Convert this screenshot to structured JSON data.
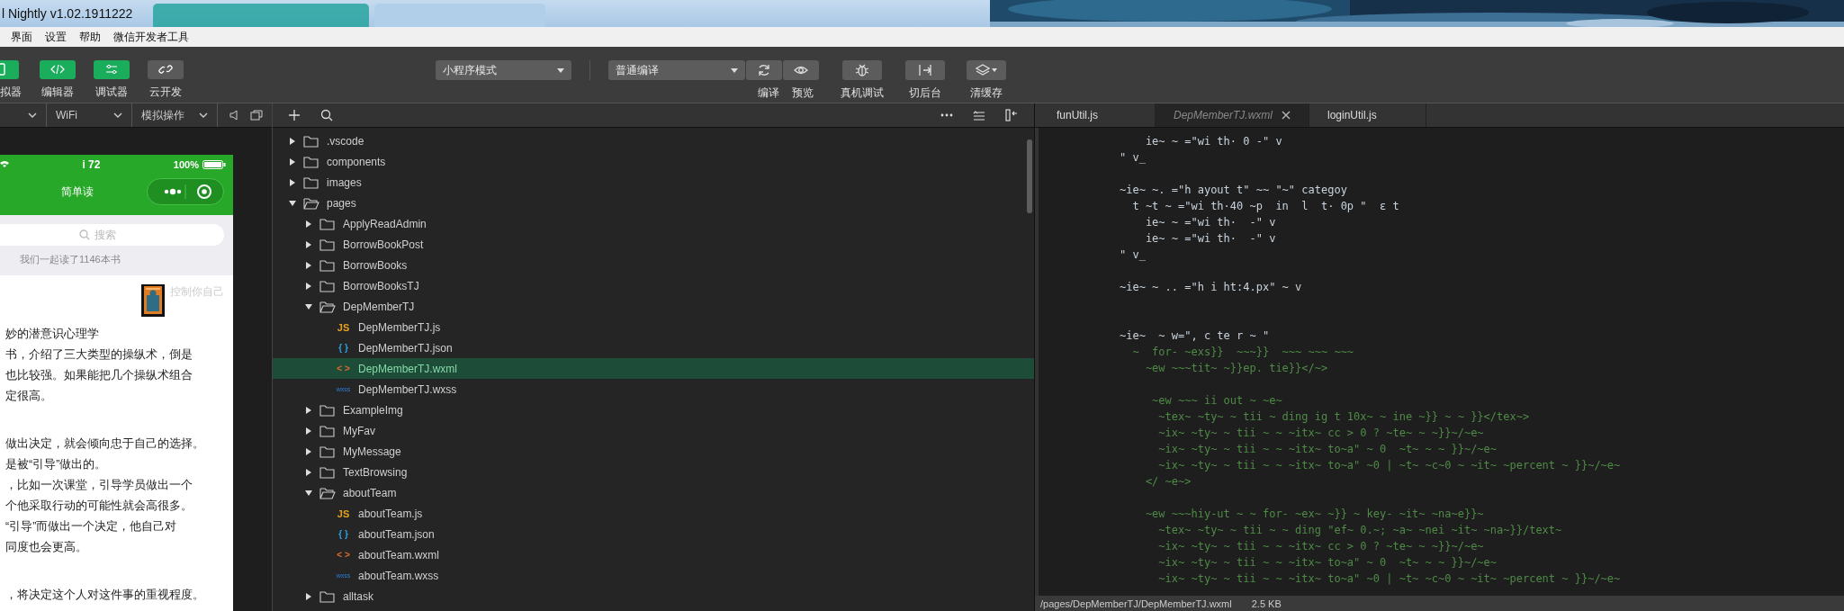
{
  "window": {
    "title": "l Nightly v1.02.1911222"
  },
  "menu": [
    "界面",
    "设置",
    "帮助",
    "微信开发者工具"
  ],
  "toolbar": {
    "views": [
      {
        "label": "拟器",
        "on": true
      },
      {
        "label": "编辑器",
        "on": true
      },
      {
        "label": "调试器",
        "on": true
      },
      {
        "label": "云开发",
        "on": false
      }
    ],
    "mode": "小程序模式",
    "compile": "普通编译",
    "actions": [
      {
        "label": "编译"
      },
      {
        "label": "预览"
      },
      {
        "label": "真机调试"
      },
      {
        "label": "切后台"
      },
      {
        "label": "清缓存"
      }
    ]
  },
  "simulator": {
    "dropdowns": [
      {
        "kind": "device"
      },
      {
        "kind": "network",
        "label": "WiFi"
      },
      {
        "kind": "operation",
        "label": "模拟操作"
      }
    ],
    "phone": {
      "time": "i 72",
      "battery": "100%",
      "title": "简单读",
      "search_placeholder": "搜索",
      "summary": "我们一起读了1146本书",
      "book_title": "控制你自己",
      "paragraphs": [
        [
          "妙的潜意识心理学",
          "书，介绍了三大类型的操纵术，倒是",
          "也比较强。如果能把几个操纵术组合",
          "定很高。"
        ],
        [
          "做出决定，就会倾向忠于自己的选择。",
          "是被“引导”做出的。",
          "，比如一次课堂，引导学员做出一个",
          "个他采取行动的可能性就会高很多。",
          "“引导”而做出一个决定，他自己对",
          "同度也会更高。"
        ],
        [
          "，将决定这个人对这件事的重视程度。"
        ]
      ]
    }
  },
  "file_tree": [
    {
      "name": ".vscode",
      "kind": "folder",
      "expanded": false,
      "selected": false
    },
    {
      "name": "components",
      "kind": "folder",
      "expanded": false,
      "selected": false
    },
    {
      "name": "images",
      "kind": "folder",
      "expanded": false,
      "selected": false
    },
    {
      "name": "pages",
      "kind": "folder",
      "expanded": true,
      "selected": false,
      "children": [
        {
          "name": "ApplyReadAdmin",
          "kind": "folder",
          "expanded": false,
          "selected": false
        },
        {
          "name": "BorrowBookPost",
          "kind": "folder",
          "expanded": false,
          "selected": false
        },
        {
          "name": "BorrowBooks",
          "kind": "folder",
          "expanded": false,
          "selected": false
        },
        {
          "name": "BorrowBooksTJ",
          "kind": "folder",
          "expanded": false,
          "selected": false
        },
        {
          "name": "DepMemberTJ",
          "kind": "folder",
          "expanded": true,
          "selected": false,
          "children": [
            {
              "name": "DepMemberTJ.js",
              "kind": "js",
              "badge": "JS",
              "selected": false
            },
            {
              "name": "DepMemberTJ.json",
              "kind": "json",
              "badge": "{ }",
              "selected": false
            },
            {
              "name": "DepMemberTJ.wxml",
              "kind": "wxml",
              "badge": "< >",
              "selected": true
            },
            {
              "name": "DepMemberTJ.wxss",
              "kind": "wxss",
              "badge": "wxss",
              "selected": false
            }
          ]
        },
        {
          "name": "ExampleImg",
          "kind": "folder",
          "expanded": false,
          "selected": false
        },
        {
          "name": "MyFav",
          "kind": "folder",
          "expanded": false,
          "selected": false
        },
        {
          "name": "MyMessage",
          "kind": "folder",
          "expanded": false,
          "selected": false
        },
        {
          "name": "TextBrowsing",
          "kind": "folder",
          "expanded": false,
          "selected": false
        },
        {
          "name": "aboutTeam",
          "kind": "folder",
          "expanded": true,
          "selected": false,
          "children": [
            {
              "name": "aboutTeam.js",
              "kind": "js",
              "badge": "JS",
              "selected": false
            },
            {
              "name": "aboutTeam.json",
              "kind": "json",
              "badge": "{ }",
              "selected": false
            },
            {
              "name": "aboutTeam.wxml",
              "kind": "wxml",
              "badge": "< >",
              "selected": false
            },
            {
              "name": "aboutTeam.wxss",
              "kind": "wxss",
              "badge": "wxss",
              "selected": false
            }
          ]
        },
        {
          "name": "alltask",
          "kind": "folder",
          "expanded": false,
          "selected": false
        }
      ]
    }
  ],
  "editor": {
    "tabs": [
      {
        "label": "funUtil.js",
        "selected": false
      },
      {
        "label": "DepMemberTJ.wxml",
        "selected": true
      },
      {
        "label": "loginUtil.js",
        "selected": false
      }
    ],
    "lines": [
      {
        "kind": "tag",
        "text": "    ie~ ~ =\"wi th· 0 -\" v"
      },
      {
        "kind": "tag",
        "text": "\" v_"
      },
      {
        "kind": "blank"
      },
      {
        "kind": "tag",
        "text": "~ie~ ~. =\"h ayout t\" ~~ \"~\" categoy"
      },
      {
        "kind": "tag",
        "text": "  t ~t ~ =\"wi th·40 ~p  in  l  t· 0p \"  ε t"
      },
      {
        "kind": "tag",
        "text": "    ie~ ~ =\"wi th·  -\" v"
      },
      {
        "kind": "tag",
        "text": "    ie~ ~ =\"wi th·  -\" v"
      },
      {
        "kind": "tag",
        "text": "\" v_"
      },
      {
        "kind": "blank"
      },
      {
        "kind": "tag",
        "text": "~ie~ ~ .. =\"h i ht:4.px\" ~ v"
      },
      {
        "kind": "blank"
      },
      {
        "kind": "blank"
      },
      {
        "kind": "tag",
        "text": "~ie~  ~ w=\", c te r ~ \""
      },
      {
        "kind": "dim",
        "text": "  ~  for- ~exs}}  ~~~}}  ~~~ ~~~ ~~~"
      },
      {
        "kind": "dim",
        "text": "    ~ew ~~~tit~ ~}}ep. tie}}</~>"
      },
      {
        "kind": "blank"
      },
      {
        "kind": "dim",
        "text": "     ~ew ~~~ ii out ~ ~e~"
      },
      {
        "kind": "dim",
        "text": "      ~tex~ ~ty~ ~ tii ~ ding ig t 10x~ ~ ine ~}} ~ ~ }}</tex~>"
      },
      {
        "kind": "dim",
        "text": "      ~ix~ ~ty~ ~ tii ~ ~ ~itx~ cc > 0 ? ~te~ ~ ~}}~/~e~"
      },
      {
        "kind": "dim",
        "text": "      ~ix~ ~ty~ ~ tii ~ ~ ~itx~ to~a\" ~ 0  ~t~ ~ ~ }}~/~e~"
      },
      {
        "kind": "dim",
        "text": "      ~ix~ ~ty~ ~ tii ~ ~ ~itx~ to~a\" ~0 | ~t~ ~c~0 ~ ~it~ ~percent ~ }}~/~e~"
      },
      {
        "kind": "dim",
        "text": "    </ ~e~>"
      },
      {
        "kind": "blank"
      },
      {
        "kind": "dim",
        "text": "    ~ew ~~~hiy-ut ~ ~ for- ~ex~ ~}} ~ key- ~it~ ~na~e}}~"
      },
      {
        "kind": "dim",
        "text": "      ~tex~ ~ty~ ~ tii ~ ~ ding \"ef~ 0.~; ~a~ ~nei ~it~ ~na~}}/text~"
      },
      {
        "kind": "dim",
        "text": "      ~ix~ ~ty~ ~ tii ~ ~ ~itx~ cc > 0 ? ~te~ ~ ~}}~/~e~"
      },
      {
        "kind": "dim",
        "text": "      ~ix~ ~ty~ ~ tii ~ ~ ~itx~ to~a\" ~ 0  ~t~ ~ ~ }}~/~e~"
      },
      {
        "kind": "dim",
        "text": "      ~ix~ ~ty~ ~ tii ~ ~ ~itx~ to~a\" ~0 | ~t~ ~c~0 ~ ~it~ ~percent ~ }}~/~e~"
      }
    ],
    "status": {
      "path": "/pages/DepMemberTJ/DepMemberTJ.wxml",
      "size": "2.5 KB"
    }
  }
}
